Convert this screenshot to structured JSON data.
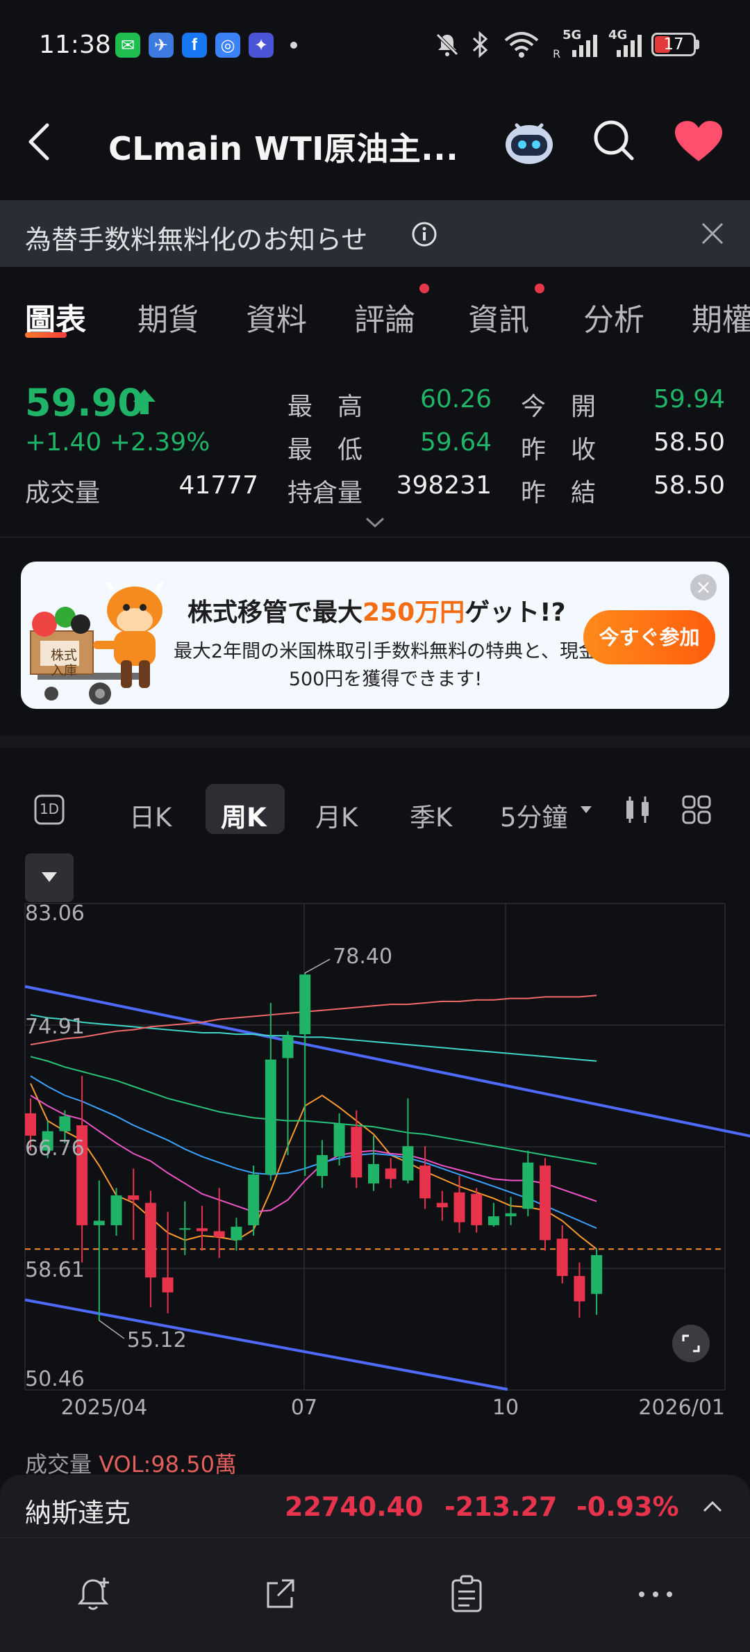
{
  "status_bar": {
    "time": "11:38",
    "apps": [
      "wechat-icon",
      "travel-app-icon",
      "facebook-icon",
      "browser-app-icon",
      "tieba-app-icon"
    ],
    "network": [
      "5G",
      "4G"
    ],
    "battery": "17"
  },
  "header": {
    "title": "CLmain  WTI原油主..."
  },
  "notice": {
    "text": "為替手数料無料化のお知らせ"
  },
  "tabs": [
    {
      "label": "圖表",
      "active": true,
      "dot": false
    },
    {
      "label": "期貨",
      "active": false,
      "dot": false
    },
    {
      "label": "資料",
      "active": false,
      "dot": false
    },
    {
      "label": "評論",
      "active": false,
      "dot": true
    },
    {
      "label": "資訊",
      "active": false,
      "dot": true
    },
    {
      "label": "分析",
      "active": false,
      "dot": false
    },
    {
      "label": "期權",
      "active": false,
      "dot": false
    }
  ],
  "quote": {
    "price": "59.90",
    "change": "+1.40",
    "change_pct": "+2.39%",
    "volume_label": "成交量",
    "volume": "41777",
    "high_label": "最　高",
    "high": "60.26",
    "low_label": "最　低",
    "low": "59.64",
    "oi_label": "持倉量",
    "oi": "398231",
    "open_label": "今　開",
    "open": "59.94",
    "prev_close_label": "昨　收",
    "prev_close": "58.50",
    "prev_settle_label": "昨　結",
    "prev_settle": "58.50"
  },
  "banner": {
    "title_pre": "株式移管で最大",
    "title_hl": "250万円",
    "title_post": "ゲット!?",
    "desc": "最大2年間の米国株取引手数料無料の特典と、現金500円を獲得できます!",
    "button": "今すぐ参加",
    "box_label": "株式入庫"
  },
  "periods": {
    "oned": "1D",
    "items": [
      "日K",
      "周K",
      "月K",
      "季K"
    ],
    "active": "周K",
    "minute": "5分鐘"
  },
  "chart_data": {
    "type": "candlestick",
    "ylim": [
      50.46,
      83.06
    ],
    "y_ticks": [
      "83.06",
      "74.91",
      "66.76",
      "58.61",
      "50.46"
    ],
    "x_ticks": [
      "2025/04",
      "07",
      "10",
      "2026/01"
    ],
    "current_price_line": 59.9,
    "annotations": {
      "max": "78.40",
      "min": "55.12"
    },
    "candles": [
      [
        69,
        67.5,
        70,
        66.5
      ],
      [
        66.5,
        67.8,
        68.5,
        66
      ],
      [
        67.8,
        68.8,
        69.2,
        67
      ],
      [
        68.2,
        61.5,
        71.5,
        59
      ],
      [
        61.5,
        61.8,
        64.5,
        55.12
      ],
      [
        61.5,
        63.5,
        64,
        60.8
      ],
      [
        63.5,
        63.2,
        65.3,
        60.5
      ],
      [
        63,
        58,
        63.8,
        56
      ],
      [
        58,
        57,
        62.4,
        55.6
      ],
      [
        61.2,
        61.3,
        63.1,
        59.5
      ],
      [
        61.3,
        61.1,
        62.8,
        59.8
      ],
      [
        61.1,
        60.7,
        64,
        59.3
      ],
      [
        60.5,
        61.4,
        62,
        59.8
      ],
      [
        61.5,
        64.9,
        65.5,
        60.8
      ],
      [
        64.9,
        72.6,
        76.4,
        64.5
      ],
      [
        72.7,
        74.2,
        74.5,
        66.2
      ],
      [
        74.3,
        78.3,
        78.4,
        64.8
      ],
      [
        64.8,
        66.2,
        67.2,
        64
      ],
      [
        66.1,
        68.3,
        69,
        65.5
      ],
      [
        68.1,
        64.7,
        69.2,
        64
      ],
      [
        64.3,
        65.6,
        67.5,
        63.8
      ],
      [
        65.3,
        64.6,
        66,
        64
      ],
      [
        64.5,
        66.8,
        70,
        64.3
      ],
      [
        65.5,
        63.3,
        66.8,
        62.6
      ],
      [
        63,
        62.7,
        63.8,
        61.8
      ],
      [
        63.7,
        61.7,
        64.8,
        61
      ],
      [
        63.6,
        61.5,
        64,
        61
      ],
      [
        61.5,
        62.1,
        63,
        61.4
      ],
      [
        62.1,
        62.3,
        63.4,
        61.5
      ],
      [
        62.6,
        65.7,
        66.5,
        62.1
      ],
      [
        65.5,
        60.5,
        66,
        59.8
      ],
      [
        60.6,
        58.1,
        61.5,
        57.6
      ],
      [
        58.1,
        56.4,
        59,
        55.3
      ],
      [
        56.9,
        59.5,
        59.9,
        55.5
      ]
    ],
    "ma_lines": [
      {
        "color": "#ff9a2e",
        "values": [
          71,
          68.5,
          67.8,
          67.2,
          65.5,
          63.5,
          63,
          62,
          61,
          60.5,
          60.8,
          60.7,
          60.5,
          61.2,
          63.8,
          66.8,
          69.5,
          70.2,
          69.4,
          68.5,
          67.6,
          66.2,
          65.7,
          65.1,
          64.6,
          64.1,
          63.7,
          63.3,
          62.8,
          62.7,
          62.5,
          61.8,
          60.8,
          59.9
        ]
      },
      {
        "color": "#f055c8",
        "values": [
          70.2,
          69.5,
          68.9,
          68.6,
          67.8,
          67,
          66.3,
          65.8,
          65,
          64.3,
          63.6,
          63.2,
          62.8,
          62.4,
          62.5,
          63.2,
          64.5,
          65.6,
          66.2,
          66.4,
          66.5,
          66.3,
          66.2,
          65.9,
          65.5,
          65.2,
          64.9,
          64.6,
          64.5,
          64.5,
          64.3,
          63.9,
          63.5,
          63.1
        ]
      },
      {
        "color": "#3ba3ff",
        "values": [
          71.5,
          70.8,
          70.2,
          69.8,
          69.3,
          68.8,
          68.2,
          67.7,
          67.2,
          66.6,
          66.1,
          65.7,
          65.3,
          65,
          64.9,
          65,
          65.3,
          65.7,
          66,
          66.2,
          66.3,
          66.2,
          66,
          65.7,
          65.3,
          64.9,
          64.5,
          64.1,
          63.7,
          63.3,
          62.8,
          62.3,
          61.8,
          61.3
        ]
      },
      {
        "color": "#27c47a",
        "values": [
          72.8,
          72.5,
          72.1,
          71.8,
          71.5,
          71.2,
          70.8,
          70.4,
          70,
          69.7,
          69.4,
          69.1,
          68.9,
          68.7,
          68.6,
          68.5,
          68.5,
          68.4,
          68.3,
          68.2,
          68.1,
          67.9,
          67.7,
          67.6,
          67.4,
          67.2,
          67,
          66.8,
          66.6,
          66.4,
          66.2,
          66,
          65.8,
          65.6
        ]
      },
      {
        "color": "#3fd6c8",
        "values": [
          75.6,
          75.4,
          75.3,
          75.1,
          75,
          74.9,
          74.8,
          74.7,
          74.6,
          74.5,
          74.4,
          74.4,
          74.3,
          74.3,
          74.2,
          74.2,
          74.1,
          74.1,
          74,
          73.9,
          73.8,
          73.7,
          73.6,
          73.5,
          73.4,
          73.3,
          73.2,
          73.1,
          73,
          72.9,
          72.8,
          72.7,
          72.6,
          72.5
        ]
      },
      {
        "color": "#f26a6a",
        "values": [
          73.6,
          73.8,
          74,
          74.1,
          74.3,
          74.5,
          74.6,
          74.8,
          74.9,
          75,
          75.1,
          75.3,
          75.4,
          75.5,
          75.6,
          75.7,
          75.8,
          75.9,
          76,
          76.1,
          76.2,
          76.3,
          76.3,
          76.4,
          76.5,
          76.5,
          76.6,
          76.6,
          76.7,
          76.7,
          76.8,
          76.8,
          76.8,
          76.9
        ]
      }
    ],
    "trend_lines": [
      {
        "color": "#4f6bff",
        "from": [
          0,
          77.5
        ],
        "to": [
          44,
          66.8
        ]
      },
      {
        "color": "#4f6bff",
        "from": [
          0,
          56.5
        ],
        "to": [
          27,
          50.5
        ]
      }
    ]
  },
  "volume": {
    "label": "成交量",
    "value": "VOL:98.50萬"
  },
  "index": {
    "name": "納斯達克",
    "value": "22740.40",
    "change": "-213.27",
    "change_pct": "-0.93%"
  },
  "bottom_nav": [
    "alert-add-icon",
    "share-icon",
    "notes-icon",
    "more-icon"
  ],
  "colors": {
    "up": "#1fb468",
    "down": "#e8334d",
    "bg": "#0f1014",
    "accent": "#ff5d0d"
  }
}
